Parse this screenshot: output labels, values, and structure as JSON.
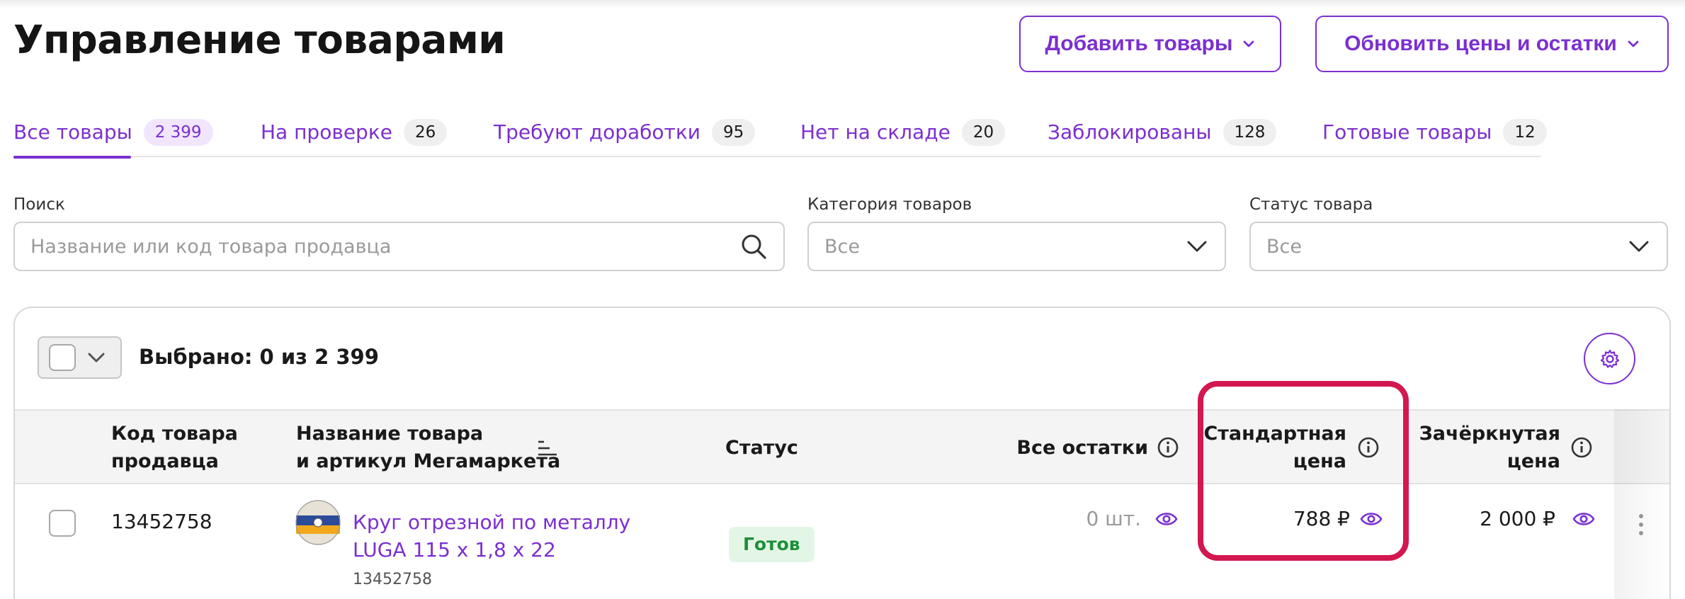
{
  "title": "Управление товарами",
  "header": {
    "add_label": "Добавить товары",
    "update_label": "Обновить цены и остатки"
  },
  "tabs": [
    {
      "label": "Все товары",
      "count": "2 399",
      "active": true
    },
    {
      "label": "На проверке",
      "count": "26"
    },
    {
      "label": "Требуют доработки",
      "count": "95"
    },
    {
      "label": "Нет на складе",
      "count": "20"
    },
    {
      "label": "Заблокированы",
      "count": "128"
    },
    {
      "label": "Готовые товары",
      "count": "12"
    }
  ],
  "filters": {
    "search_label": "Поиск",
    "search_placeholder": "Название или код товара продавца",
    "category_label": "Категория товаров",
    "category_value": "Все",
    "status_label": "Статус товара",
    "status_value": "Все"
  },
  "table": {
    "selected_text": "Выбрано: 0 из 2 399",
    "columns": {
      "code": [
        "Код товара",
        "продавца"
      ],
      "name": [
        "Название товара",
        "и артикул Мегамаркета"
      ],
      "status": "Статус",
      "stock": "Все остатки",
      "std_price": [
        "Стандартная",
        "цена"
      ],
      "strike_price": [
        "Зачёркнутая",
        "цена"
      ]
    },
    "rows": [
      {
        "code": "13452758",
        "name": "Круг отрезной по металлу LUGA 115 х 1,8 х 22",
        "sku": "13452758",
        "status": "Готов",
        "stock": "0 шт.",
        "std_price": "788 ₽",
        "strike_price": "2 000 ₽"
      }
    ]
  },
  "colors": {
    "accent": "#7b2fd0",
    "highlight": "#d3174f",
    "status_ready_bg": "#e3f6e6",
    "status_ready_text": "#1f8f3a"
  },
  "icons": [
    "chevron-down-icon",
    "search-icon",
    "gear-icon",
    "info-icon",
    "eye-icon",
    "sort-icon",
    "kebab-icon"
  ]
}
